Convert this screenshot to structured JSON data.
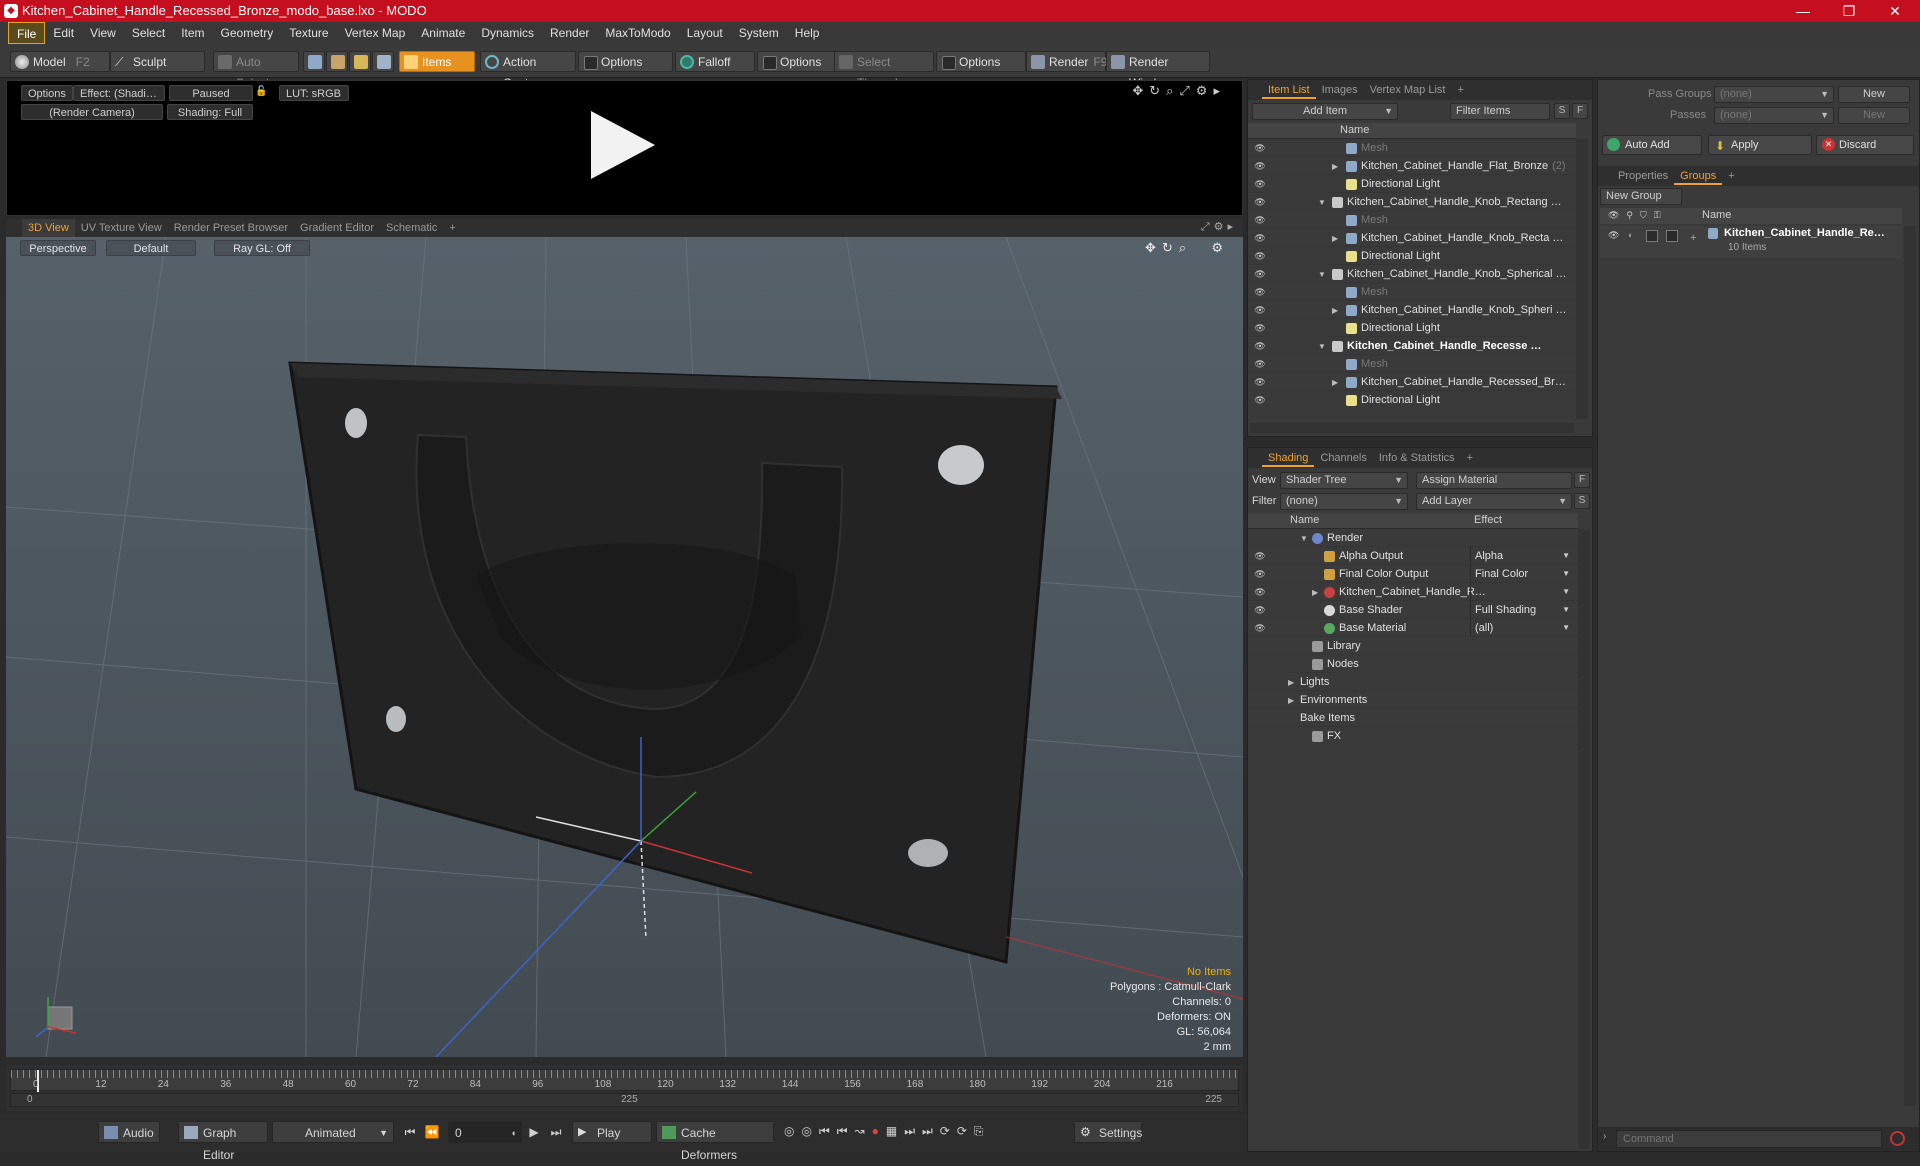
{
  "window": {
    "title": "Kitchen_Cabinet_Handle_Recessed_Bronze_modo_base.lxo - MODO"
  },
  "menu": [
    "File",
    "Edit",
    "View",
    "Select",
    "Item",
    "Geometry",
    "Texture",
    "Vertex Map",
    "Animate",
    "Dynamics",
    "Render",
    "MaxToModo",
    "Layout",
    "System",
    "Help"
  ],
  "toolbar": {
    "model": "Model",
    "model_key": "F2",
    "sculpt": "Sculpt",
    "auto_select": "Auto Select",
    "items": "Items",
    "action_center": "Action Center",
    "options1": "Options",
    "falloff": "Falloff",
    "options2": "Options",
    "select_through": "Select Through",
    "options3": "Options",
    "render": "Render",
    "render_key": "F9",
    "render_window": "Render Window"
  },
  "preview": {
    "options": "Options",
    "effect": "Effect: (Shadi…",
    "paused": "Paused",
    "lut": "LUT: sRGB",
    "camera": "(Render Camera)",
    "shading": "Shading: Full"
  },
  "view_tabs": [
    "3D View",
    "UV Texture View",
    "Render Preset Browser",
    "Gradient Editor",
    "Schematic",
    "+"
  ],
  "viewport": {
    "perspective": "Perspective",
    "default": "Default",
    "raygl": "Ray GL: Off",
    "info": {
      "items": "No Items",
      "polygons": "Polygons : Catmull-Clark",
      "channels": "Channels: 0",
      "deformers": "Deformers: ON",
      "gl": "GL: 56,064",
      "scale": "2 mm"
    }
  },
  "timeline": {
    "ticks": [
      "0",
      "12",
      "24",
      "36",
      "48",
      "60",
      "72",
      "84",
      "96",
      "108",
      "120",
      "132",
      "144",
      "156",
      "168",
      "180",
      "192",
      "204",
      "216"
    ],
    "start": "0",
    "mid": "225",
    "end": "225"
  },
  "transport": {
    "audio": "Audio",
    "graph_editor": "Graph Editor",
    "animated": "Animated",
    "frame": "0",
    "play": "Play",
    "cache_deformers": "Cache Deformers",
    "settings": "Settings"
  },
  "item_list": {
    "tabs": [
      "Item List",
      "Images",
      "Vertex Map List",
      "+"
    ],
    "add_item": "Add Item",
    "filter_items": "Filter Items",
    "s": "S",
    "f": "F",
    "col_name": "Name",
    "rows": [
      {
        "label": "Mesh",
        "indent": 3,
        "kind": "mesh",
        "dim": true,
        "expander": ""
      },
      {
        "label": "Kitchen_Cabinet_Handle_Flat_Bronze",
        "suffix": "(2)",
        "indent": 3,
        "kind": "mesh",
        "dim": false,
        "expander": "▶"
      },
      {
        "label": "Directional Light",
        "indent": 3,
        "kind": "light",
        "dim": false,
        "expander": ""
      },
      {
        "label": "Kitchen_Cabinet_Handle_Knob_Rectang …",
        "indent": 2,
        "kind": "scene",
        "dim": false,
        "expander": "▼"
      },
      {
        "label": "Mesh",
        "indent": 3,
        "kind": "mesh",
        "dim": true,
        "expander": ""
      },
      {
        "label": "Kitchen_Cabinet_Handle_Knob_Recta …",
        "indent": 3,
        "kind": "mesh",
        "dim": false,
        "expander": "▶"
      },
      {
        "label": "Directional Light",
        "indent": 3,
        "kind": "light",
        "dim": false,
        "expander": ""
      },
      {
        "label": "Kitchen_Cabinet_Handle_Knob_Spherical …",
        "indent": 2,
        "kind": "scene",
        "dim": false,
        "expander": "▼"
      },
      {
        "label": "Mesh",
        "indent": 3,
        "kind": "mesh",
        "dim": true,
        "expander": ""
      },
      {
        "label": "Kitchen_Cabinet_Handle_Knob_Spheri …",
        "indent": 3,
        "kind": "mesh",
        "dim": false,
        "expander": "▶"
      },
      {
        "label": "Directional Light",
        "indent": 3,
        "kind": "light",
        "dim": false,
        "expander": ""
      },
      {
        "label": "Kitchen_Cabinet_Handle_Recesse …",
        "indent": 2,
        "kind": "scene",
        "dim": false,
        "bold": true,
        "expander": "▼"
      },
      {
        "label": "Mesh",
        "indent": 3,
        "kind": "mesh",
        "dim": true,
        "expander": ""
      },
      {
        "label": "Kitchen_Cabinet_Handle_Recessed_Br…",
        "indent": 3,
        "kind": "mesh",
        "dim": false,
        "expander": "▶"
      },
      {
        "label": "Directional Light",
        "indent": 3,
        "kind": "light",
        "dim": false,
        "expander": ""
      }
    ]
  },
  "shading": {
    "tabs": [
      "Shading",
      "Channels",
      "Info & Statistics",
      "+"
    ],
    "view_label": "View",
    "view_value": "Shader Tree",
    "assign_material": "Assign Material",
    "filter_label": "Filter",
    "filter_value": "(none)",
    "add_layer": "Add Layer",
    "f": "F",
    "s": "S",
    "col_name": "Name",
    "col_effect": "Effect",
    "rows": [
      {
        "label": "Render",
        "effect": "",
        "indent": 1,
        "kind": "render",
        "eye": false,
        "expander": "▼"
      },
      {
        "label": "Alpha Output",
        "effect": "Alpha",
        "indent": 2,
        "kind": "output",
        "eye": true,
        "expander": ""
      },
      {
        "label": "Final Color Output",
        "effect": "Final Color",
        "indent": 2,
        "kind": "output",
        "eye": true,
        "expander": ""
      },
      {
        "label": "Kitchen_Cabinet_Handle_R…",
        "effect": "",
        "indent": 2,
        "kind": "mat",
        "eye": true,
        "expander": "▶"
      },
      {
        "label": "Base Shader",
        "effect": "Full Shading",
        "indent": 2,
        "kind": "shader",
        "eye": true,
        "expander": ""
      },
      {
        "label": "Base Material",
        "effect": "(all)",
        "indent": 2,
        "kind": "basemat",
        "eye": true,
        "expander": ""
      },
      {
        "label": "Library",
        "effect": "",
        "indent": 1,
        "kind": "folder",
        "eye": false,
        "expander": ""
      },
      {
        "label": "Nodes",
        "effect": "",
        "indent": 1,
        "kind": "folder",
        "eye": false,
        "expander": ""
      },
      {
        "label": "Lights",
        "effect": "",
        "indent": 0,
        "kind": "none",
        "eye": false,
        "expander": "▶"
      },
      {
        "label": "Environments",
        "effect": "",
        "indent": 0,
        "kind": "none",
        "eye": false,
        "expander": "▶"
      },
      {
        "label": "Bake Items",
        "effect": "",
        "indent": 0,
        "kind": "none",
        "eye": false,
        "expander": ""
      },
      {
        "label": "FX",
        "effect": "",
        "indent": 1,
        "kind": "fx",
        "eye": false,
        "expander": ""
      }
    ]
  },
  "groups_panel": {
    "pass_groups_label": "Pass Groups",
    "pass_groups_value": "(none)",
    "new": "New",
    "passes_label": "Passes",
    "passes_value": "(none)",
    "new2": "New",
    "auto_add": "Auto Add",
    "apply": "Apply",
    "discard": "Discard",
    "tabs": [
      "Properties",
      "Groups",
      "+"
    ],
    "new_group": "New Group",
    "col_name": "Name",
    "group_name": "Kitchen_Cabinet_Handle_Re…",
    "group_count": "10 Items",
    "command_placeholder": "Command"
  },
  "colors": {
    "accent": "#f0a030",
    "title_bar": "#c50f1f"
  }
}
